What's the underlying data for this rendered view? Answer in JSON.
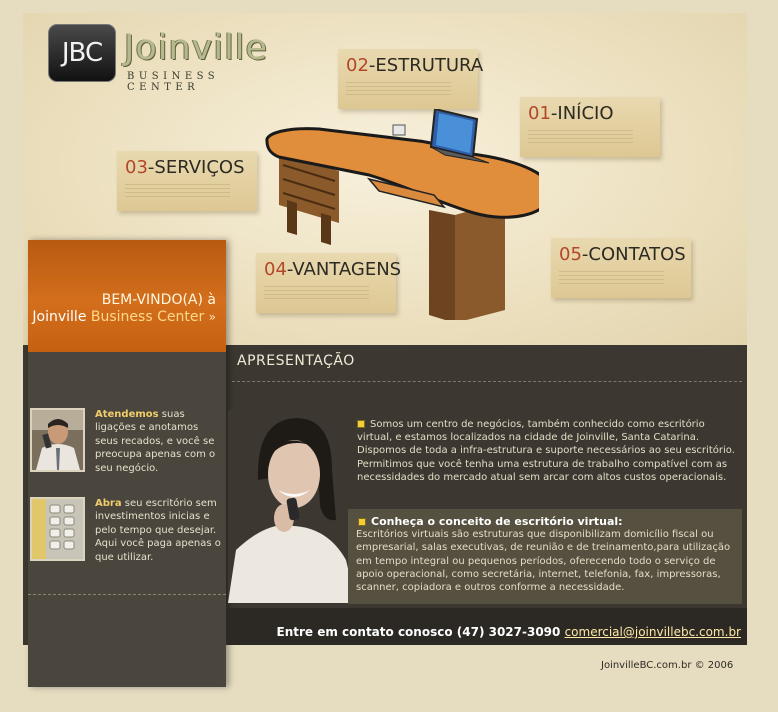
{
  "logo": {
    "mark": "JBC",
    "name": "Joinville",
    "subtitle": "BUSINESS CENTER"
  },
  "nav": [
    {
      "num": "02",
      "label": "-ESTRUTURA"
    },
    {
      "num": "01",
      "label": "-INÍCIO"
    },
    {
      "num": "03",
      "label": "-SERVIÇOS"
    },
    {
      "num": "04",
      "label": "-VANTAGENS"
    },
    {
      "num": "05",
      "label": "-CONTATOS"
    }
  ],
  "welcome": {
    "line1": "BEM-VINDO(A) à",
    "line2_a": "Joinville ",
    "line2_b": "Business Center",
    "arrows": "»"
  },
  "sidebar": {
    "items": [
      {
        "lead": "Atendemos",
        "text": " suas ligações e anotamos seus recados, e você se preocupa apenas com o seu negócio."
      },
      {
        "lead": "Abra",
        "text": " seu escritório sem investimentos inicias e pelo tempo que desejar. Aqui você paga apenas o que utilizar."
      }
    ]
  },
  "main": {
    "title": "APRESENTAÇÃO",
    "intro": "Somos um centro de negócios, também conhecido como escritório virtual, e estamos localizados na cidade de Joinville, Santa Catarina. Dispomos de toda a infra-estrutura e suporte necessários ao seu escritório. Permitimos que você tenha uma estrutura de trabalho compatível com as necessidades do mercado atual sem arcar com altos custos operacionais.",
    "concept_title": "Conheça o conceito de escritório virtual:",
    "concept_text": "Escritórios virtuais são estruturas que disponibilizam domicílio fiscal ou empresarial, salas executivas, de reunião e de treinamento,para utilização em tempo integral ou pequenos períodos, oferecendo todo o serviço de apoio operacional, como secretária, internet, telefonia, fax, impressoras, scanner, copiadora e outros conforme a necessidade."
  },
  "contact": {
    "text": "Entre em contato conosco (47) 3027-3090 ",
    "email": "comercial@joinvillebc.com.br"
  },
  "footer": "JoinvilleBC.com.br © 2006",
  "colors": {
    "accent_orange": "#d36f1c",
    "number_red": "#b2472a",
    "panel_dark": "#3c3831",
    "highlight_yellow": "#f0cc6b"
  }
}
